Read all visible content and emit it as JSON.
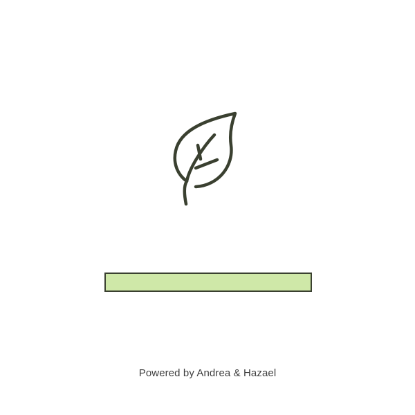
{
  "loader": {
    "icon": "leaf-icon",
    "progress_fraction": 1.0,
    "colors": {
      "stroke": "#3a4030",
      "fill": "#cfe8a8",
      "background": "#ffffff"
    }
  },
  "footer": {
    "powered_by": "Powered by Andrea & Hazael"
  }
}
